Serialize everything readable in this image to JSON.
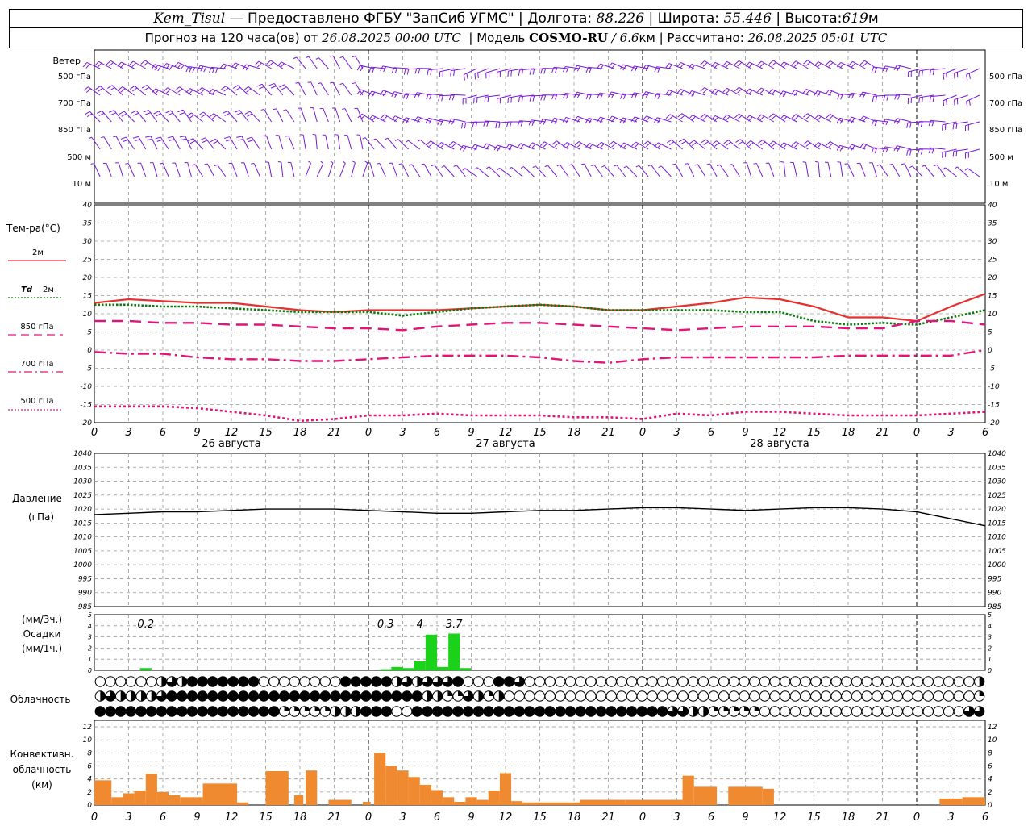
{
  "header": {
    "station": "Kem_Tisul",
    "provider": "— Предоставлено ФГБУ \"ЗапСиб УГМС\" |",
    "lon_label": "Долгота:",
    "lon_value": "88.226",
    "lat_label": "| Широта:",
    "lat_value": "55.446",
    "alt_label": "| Высота:",
    "alt_value": "619",
    "alt_unit": "м",
    "forecast_label": "Прогноз на 120 часа(ов) от",
    "forecast_start": "26.08.2025 00:00 UTC",
    "model_label": "| Модель",
    "model_name": "COSMO-RU",
    "model_sep": "/",
    "model_res": "6.6",
    "model_res_unit": "км",
    "calc_label": "| Рассчитано:",
    "calc_time": "26.08.2025 05:01 UTC"
  },
  "labels": {
    "wind": "Ветер",
    "wind_levels": [
      "500 гПа",
      "700 гПа",
      "850 гПа",
      "500 м",
      "10  м"
    ],
    "temp_title": "Тем-ра(°C)",
    "t2m": "2м",
    "td_a": "Td",
    "td_b": "2м",
    "t850": "850 гПа",
    "t700": "700 гПа",
    "t500": "500 гПа",
    "pressure_a": "Давление",
    "pressure_b": "(гПа)",
    "precip_a": "(мм/3ч.)",
    "precip_b": "Осадки",
    "precip_c": "(мм/1ч.)",
    "cloud": "Облачность",
    "conv_a": "Конвективн.",
    "conv_b": "облачность",
    "conv_c": "(км)"
  },
  "colors": {
    "wind_barb": "#7b18d8",
    "t2m": "#e83030",
    "td2m": "#0a7a0a",
    "t850": "#e0147a",
    "t700": "#e0147a",
    "t500": "#e0147a",
    "pressure": "#000000",
    "precip": "#19d219",
    "convective": "#f08a30"
  },
  "chart_data": {
    "type": "line",
    "x_ticks": [
      "0",
      "3",
      "6",
      "9",
      "12",
      "15",
      "18",
      "21",
      "0",
      "3",
      "6",
      "9",
      "12",
      "15",
      "18",
      "21",
      "0",
      "3",
      "6",
      "9",
      "12",
      "15",
      "18",
      "21",
      "0",
      "3",
      "6"
    ],
    "day_labels": [
      "26 августа",
      "27 августа",
      "28 августа"
    ],
    "temperature": {
      "ylim": [
        -20,
        40
      ],
      "yticks": [
        "40",
        "35",
        "30",
        "25",
        "20",
        "15",
        "10",
        "5",
        "0",
        "-5",
        "-10",
        "-15",
        "-20"
      ],
      "hours": [
        0,
        3,
        6,
        9,
        12,
        15,
        18,
        21,
        24,
        27,
        30,
        33,
        36,
        39,
        42,
        45,
        48,
        51,
        54,
        57,
        60,
        63,
        66,
        69,
        72,
        75,
        78
      ],
      "series": [
        {
          "key": "t2m",
          "values": [
            13,
            14,
            13.5,
            13,
            13,
            12,
            11,
            10.5,
            11,
            11,
            11,
            11.5,
            12,
            12.5,
            12,
            11,
            11,
            12,
            13,
            14.5,
            14,
            12,
            9,
            9,
            8,
            12,
            15.5
          ]
        },
        {
          "key": "td2m",
          "values": [
            12.5,
            12.5,
            12,
            12,
            11.5,
            11,
            10.5,
            10.5,
            10.5,
            9.5,
            10.5,
            11.5,
            12,
            12.5,
            12,
            11,
            11,
            11,
            11,
            10.5,
            10.5,
            8,
            7,
            7.5,
            7,
            9,
            11
          ]
        },
        {
          "key": "t850",
          "values": [
            8,
            8,
            7.5,
            7.5,
            7,
            7,
            6.5,
            6,
            6,
            5.5,
            6.5,
            7,
            7.5,
            7.5,
            7,
            6.5,
            6,
            5.5,
            6,
            6.5,
            6.5,
            6.5,
            6,
            6,
            8,
            8,
            7
          ]
        },
        {
          "key": "t700",
          "values": [
            -0.5,
            -1,
            -1,
            -2,
            -2.5,
            -2.5,
            -3,
            -3,
            -2.5,
            -2,
            -1.5,
            -1.5,
            -1.5,
            -2,
            -3,
            -3.5,
            -2.5,
            -2,
            -2,
            -2,
            -2,
            -2,
            -1.5,
            -1.5,
            -1.5,
            -1.5,
            0
          ]
        },
        {
          "key": "t500",
          "values": [
            -15.5,
            -15.5,
            -15.5,
            -16,
            -17,
            -18,
            -19.5,
            -19,
            -18,
            -18,
            -17.5,
            -18,
            -18,
            -18,
            -18.5,
            -18.5,
            -19,
            -17.5,
            -18,
            -17,
            -17,
            -17.5,
            -18,
            -18,
            -18,
            -17.5,
            -17
          ]
        }
      ]
    },
    "pressure": {
      "ylim": [
        985,
        1040
      ],
      "yticks": [
        "1040",
        "1035",
        "1030",
        "1025",
        "1020",
        "1015",
        "1010",
        "1005",
        "1000",
        "995",
        "990",
        "985"
      ],
      "hours": [
        0,
        3,
        6,
        9,
        12,
        15,
        18,
        21,
        24,
        27,
        30,
        33,
        36,
        39,
        42,
        45,
        48,
        51,
        54,
        57,
        60,
        63,
        66,
        69,
        72,
        75,
        78
      ],
      "values": [
        1018,
        1018.5,
        1019,
        1019,
        1019.5,
        1020,
        1020,
        1020,
        1019.5,
        1019,
        1018.5,
        1018.5,
        1019,
        1019.5,
        1019.5,
        1020,
        1020.5,
        1020.5,
        1020,
        1019.5,
        1020,
        1020.5,
        1020.5,
        1020,
        1019,
        1016.5,
        1014
      ]
    },
    "precip": {
      "ylim": [
        0,
        5
      ],
      "yticks": [
        "5",
        "4",
        "3",
        "2",
        "1",
        "0"
      ],
      "bars": [
        {
          "h": 4,
          "v": 0.2
        },
        {
          "h": 25,
          "v": 0.1
        },
        {
          "h": 26,
          "v": 0.3
        },
        {
          "h": 27,
          "v": 0.2
        },
        {
          "h": 28,
          "v": 0.8
        },
        {
          "h": 29,
          "v": 3.2
        },
        {
          "h": 30,
          "v": 0.3
        },
        {
          "h": 31,
          "v": 3.3
        },
        {
          "h": 32,
          "v": 0.2
        }
      ],
      "labels": [
        {
          "h": 4.5,
          "text": "0.2"
        },
        {
          "h": 25.5,
          "text": "0.3"
        },
        {
          "h": 28.5,
          "text": "4"
        },
        {
          "h": 31.5,
          "text": "3.7"
        }
      ]
    },
    "cloud_rows": {
      "codes": "0 empty, 1 quarter, 2 half, 3 three-quarter, 4 full",
      "rows": [
        "000000232444444400000000444442323334000443000000000000000000000000000000000000000000002",
        "232222344444444444444444444444442211321200000000000000000000000000000000000000000000001",
        "444444444444444444111112224440044444444444444444444444443322111110000000000000000000033"
      ]
    },
    "convective": {
      "ylim": [
        0,
        13
      ],
      "yticks": [
        "12",
        "10",
        "8",
        "6",
        "4",
        "2",
        "0"
      ],
      "bars": [
        {
          "h0": 0,
          "h1": 1.5,
          "v": 3.8
        },
        {
          "h0": 1.5,
          "h1": 2.5,
          "v": 1.2
        },
        {
          "h0": 2.5,
          "h1": 3.5,
          "v": 1.8
        },
        {
          "h0": 3.5,
          "h1": 4.5,
          "v": 2.2
        },
        {
          "h0": 4.5,
          "h1": 5.5,
          "v": 4.8
        },
        {
          "h0": 5.5,
          "h1": 6.5,
          "v": 2.0
        },
        {
          "h0": 6.5,
          "h1": 7.5,
          "v": 1.5
        },
        {
          "h0": 7.5,
          "h1": 9.5,
          "v": 1.2
        },
        {
          "h0": 9.5,
          "h1": 12.5,
          "v": 3.3
        },
        {
          "h0": 12.5,
          "h1": 13.5,
          "v": 0.4
        },
        {
          "h0": 15,
          "h1": 17,
          "v": 5.2
        },
        {
          "h0": 17.5,
          "h1": 18.3,
          "v": 1.5
        },
        {
          "h0": 18.5,
          "h1": 19.5,
          "v": 5.3
        },
        {
          "h0": 20.5,
          "h1": 22.5,
          "v": 0.8
        },
        {
          "h0": 23.5,
          "h1": 24.2,
          "v": 0.5
        },
        {
          "h0": 24.5,
          "h1": 25.5,
          "v": 8.0
        },
        {
          "h0": 25.5,
          "h1": 26.5,
          "v": 6.0
        },
        {
          "h0": 26.5,
          "h1": 27.5,
          "v": 5.3
        },
        {
          "h0": 27.5,
          "h1": 28.5,
          "v": 4.3
        },
        {
          "h0": 28.5,
          "h1": 29.5,
          "v": 3.1
        },
        {
          "h0": 29.5,
          "h1": 30.5,
          "v": 2.3
        },
        {
          "h0": 30.5,
          "h1": 31.5,
          "v": 1.2
        },
        {
          "h0": 31.5,
          "h1": 32.5,
          "v": 0.5
        },
        {
          "h0": 32.5,
          "h1": 33.5,
          "v": 1.2
        },
        {
          "h0": 33.5,
          "h1": 34.5,
          "v": 0.8
        },
        {
          "h0": 34.5,
          "h1": 35.5,
          "v": 2.2
        },
        {
          "h0": 35.5,
          "h1": 36.5,
          "v": 4.9
        },
        {
          "h0": 36.5,
          "h1": 37.5,
          "v": 0.6
        },
        {
          "h0": 37.5,
          "h1": 38.5,
          "v": 0.4
        },
        {
          "h0": 38.5,
          "h1": 42.5,
          "v": 0.4
        },
        {
          "h0": 42.5,
          "h1": 46.5,
          "v": 0.8
        },
        {
          "h0": 46.5,
          "h1": 51.5,
          "v": 0.8
        },
        {
          "h0": 51.5,
          "h1": 52.5,
          "v": 4.5
        },
        {
          "h0": 52.5,
          "h1": 54.5,
          "v": 2.8
        },
        {
          "h0": 55.5,
          "h1": 58.5,
          "v": 2.8
        },
        {
          "h0": 58.5,
          "h1": 59.5,
          "v": 2.5
        },
        {
          "h0": 74,
          "h1": 76,
          "v": 1.0
        },
        {
          "h0": 76,
          "h1": 78,
          "v": 1.2
        }
      ]
    }
  }
}
